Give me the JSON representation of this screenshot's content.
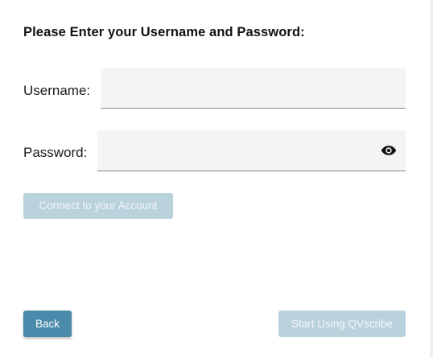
{
  "login": {
    "heading": "Please Enter your Username and Password:",
    "username_label": "Username:",
    "username_value": "",
    "password_label": "Password:",
    "password_value": "",
    "password_toggle_icon": "eye-icon",
    "connect_label": "Connect to your Account"
  },
  "footer": {
    "back_label": "Back",
    "start_label": "Start Using QVscribe"
  },
  "colors": {
    "primary_button": "#4a8aaa",
    "disabled_button": "#b9d2dc",
    "field_background": "#f4f4f4"
  }
}
